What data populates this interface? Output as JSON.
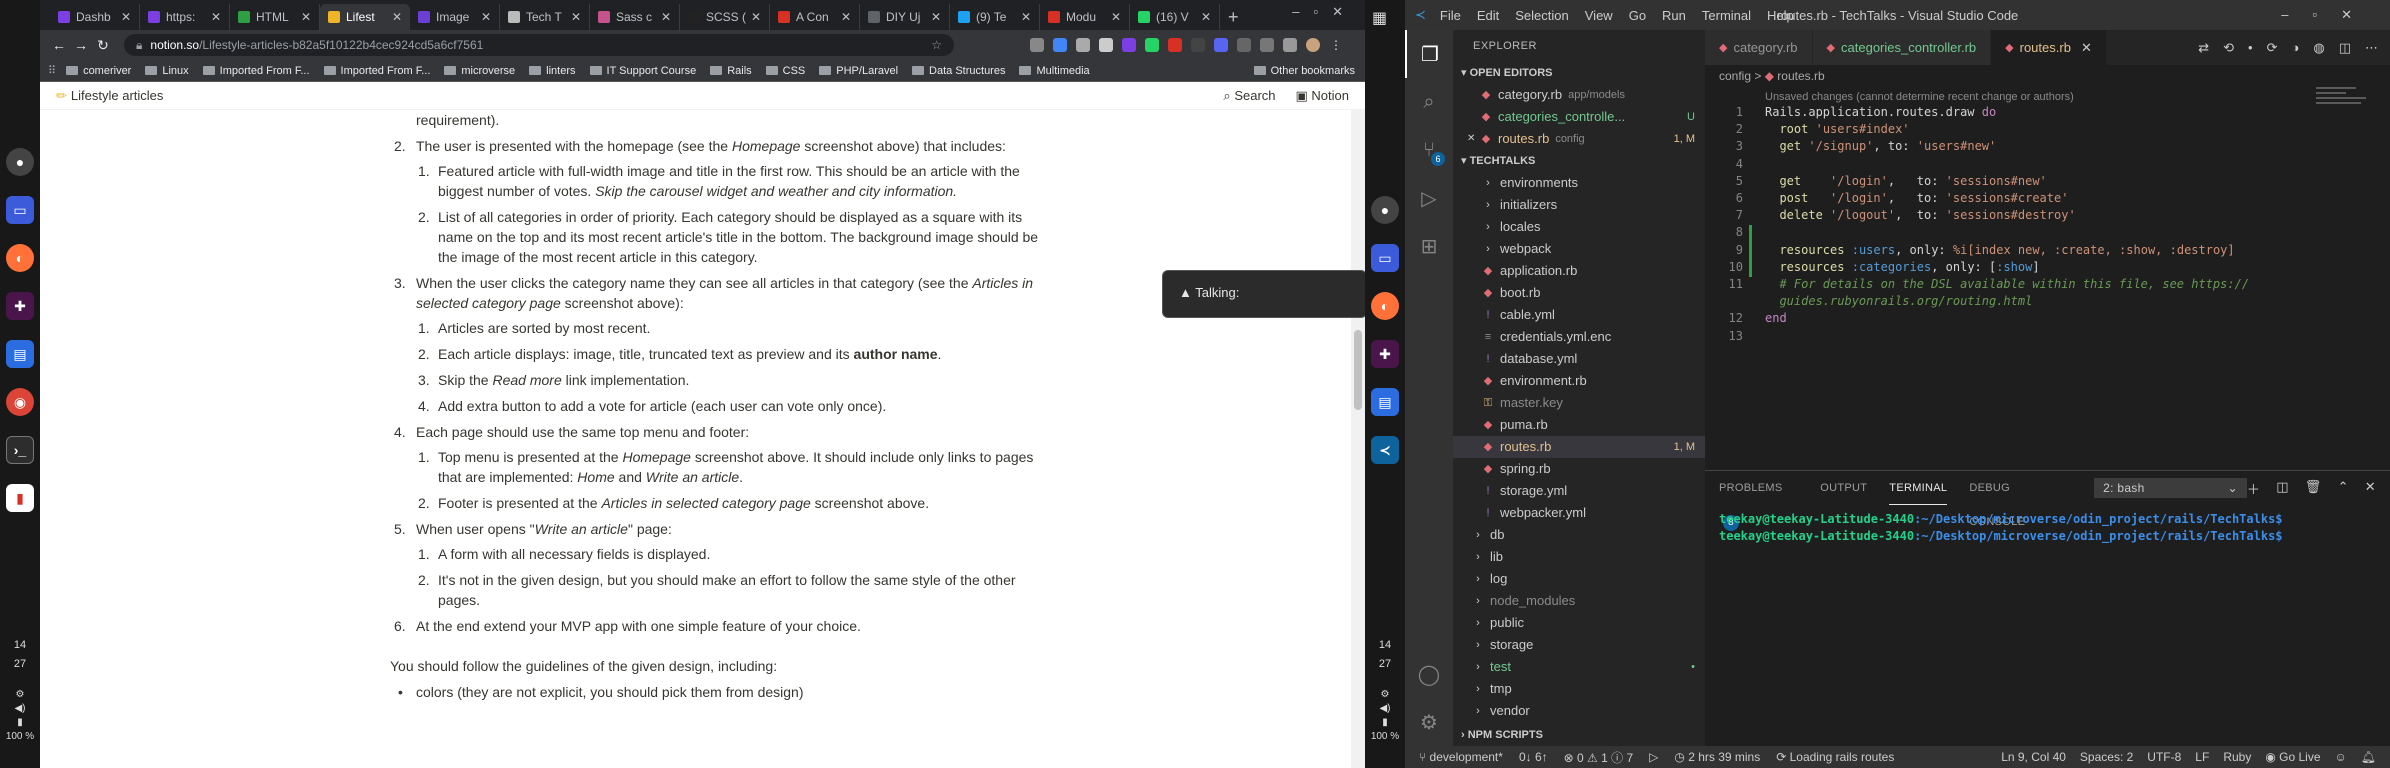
{
  "dock_left": {
    "clock_hour": "14",
    "clock_min": "27",
    "battery": "100 %"
  },
  "dock_mid": {
    "clock_hour": "14",
    "clock_min": "27",
    "battery": "100 %"
  },
  "browser": {
    "tabs": [
      {
        "label": "Dashb",
        "color": "#7b3fe4"
      },
      {
        "label": "https:",
        "color": "#7b3fe4"
      },
      {
        "label": "HTML",
        "color": "#2ea043"
      },
      {
        "label": "Lifest",
        "color": "#f0b429",
        "active": true
      },
      {
        "label": "Image",
        "color": "#6b3fd6"
      },
      {
        "label": "Tech T",
        "color": "#bbbbbb"
      },
      {
        "label": "Sass c",
        "color": "#c6538c"
      },
      {
        "label": "SCSS (",
        "color": "#222222"
      },
      {
        "label": "A Con",
        "color": "#d93025"
      },
      {
        "label": "DIY Uj",
        "color": "#5f6368"
      },
      {
        "label": "(9) Te",
        "color": "#1da1f2"
      },
      {
        "label": "Modu",
        "color": "#d93025"
      },
      {
        "label": "(16) V",
        "color": "#25d366"
      }
    ],
    "url_domain": "notion.so",
    "url_path": "/Lifestyle-articles-b82a5f10122b4cec924cd5a6cf7561",
    "bookmarks": [
      "comeriver",
      "Linux",
      "Imported From F...",
      "Imported From F...",
      "microverse",
      "linters",
      "IT Support Course",
      "Rails",
      "CSS",
      "PHP/Laravel",
      "Data Structures",
      "Multimedia"
    ],
    "other_bookmarks": "Other bookmarks"
  },
  "notion": {
    "page_title": "Lifestyle articles",
    "search": "Search",
    "notion": "Notion",
    "talking": "▲ Talking:"
  },
  "doc": {
    "l0": "requirement).",
    "l1_2": "The user is presented with the homepage (see the ",
    "l1_2_em": "Homepage",
    "l1_2_tail": " screenshot above) that includes:",
    "s2_1a": "Featured article with full-width image and title in the first row. This should be an article with the biggest number of votes. ",
    "s2_1em": "Skip the carousel widget and weather and city information.",
    "s2_2": "List of all categories in order of priority. Each category should be displayed as a square with its name on the top and its most recent article's title in the bottom. The background image should be the image of the most recent article in this category.",
    "l1_3": "When the user clicks the category name they can see all articles in that category (see the ",
    "l1_3_em": "Articles in selected category page",
    "l1_3_tail": " screenshot above):",
    "s3_1": "Articles are sorted by most recent.",
    "s3_2a": "Each article displays: image, title, truncated text as preview and its ",
    "s3_2b": "author name",
    "s3_2c": ".",
    "s3_3a": "Skip the ",
    "s3_3em": "Read more",
    "s3_3b": " link implementation.",
    "s3_4": "Add extra button to add a vote for article (each user can vote only once).",
    "l1_4": "Each page should use the same top menu and footer:",
    "s4_1a": "Top menu is presented at the ",
    "s4_1em1": "Homepage",
    "s4_1b": " screenshot above. It should include only links to pages that are implemented: ",
    "s4_1em2": "Home",
    "s4_1c": " and ",
    "s4_1em3": "Write an article",
    "s4_1d": ".",
    "s4_2a": "Footer is presented at the ",
    "s4_2em": "Articles in selected category page",
    "s4_2b": " screenshot above.",
    "l1_5a": "When user opens \"",
    "l1_5em": "Write an article",
    "l1_5b": "\" page:",
    "s5_1": "A form with all necessary fields is displayed.",
    "s5_2": "It's not in the given design, but you should make an effort to follow the same style of the other pages.",
    "l1_6": "At the end extend your MVP app with one simple feature of your choice.",
    "guidelines": "You should follow the guidelines of the given design, including:",
    "bullet1": "colors (they are not explicit, you should pick them from design)"
  },
  "vscode": {
    "menus": [
      "File",
      "Edit",
      "Selection",
      "View",
      "Go",
      "Run",
      "Terminal",
      "Help"
    ],
    "window_title": "routes.rb - TechTalks - Visual Studio Code",
    "explorer_title": "EXPLORER",
    "open_editors_title": "OPEN EDITORS",
    "open_editors": [
      {
        "name": "category.rb",
        "hint": "app/models",
        "flag": ""
      },
      {
        "name": "categories_controlle...",
        "hint": "",
        "flag": "U"
      },
      {
        "name": "routes.rb",
        "hint": "config",
        "flag": "1, M"
      }
    ],
    "project": "TECHTALKS",
    "tree": [
      {
        "name": "environments",
        "type": "folder",
        "flag": ""
      },
      {
        "name": "initializers",
        "type": "folder",
        "flag": ""
      },
      {
        "name": "locales",
        "type": "folder",
        "flag": ""
      },
      {
        "name": "webpack",
        "type": "folder",
        "flag": ""
      },
      {
        "name": "application.rb",
        "type": "ruby",
        "flag": ""
      },
      {
        "name": "boot.rb",
        "type": "ruby",
        "flag": ""
      },
      {
        "name": "cable.yml",
        "type": "yml",
        "flag": ""
      },
      {
        "name": "credentials.yml.enc",
        "type": "file",
        "flag": ""
      },
      {
        "name": "database.yml",
        "type": "yml",
        "flag": ""
      },
      {
        "name": "environment.rb",
        "type": "ruby",
        "flag": ""
      },
      {
        "name": "master.key",
        "type": "key",
        "flag": ""
      },
      {
        "name": "puma.rb",
        "type": "ruby",
        "flag": ""
      },
      {
        "name": "routes.rb",
        "type": "ruby",
        "flag": "1, M"
      },
      {
        "name": "spring.rb",
        "type": "ruby",
        "flag": ""
      },
      {
        "name": "storage.yml",
        "type": "yml",
        "flag": ""
      },
      {
        "name": "webpacker.yml",
        "type": "yml",
        "flag": ""
      }
    ],
    "tree2": [
      {
        "name": "db",
        "flag": ""
      },
      {
        "name": "lib",
        "flag": ""
      },
      {
        "name": "log",
        "flag": ""
      },
      {
        "name": "node_modules",
        "flag": ""
      },
      {
        "name": "public",
        "flag": ""
      },
      {
        "name": "storage",
        "flag": ""
      },
      {
        "name": "test",
        "flag": "•"
      },
      {
        "name": "tmp",
        "flag": ""
      },
      {
        "name": "vendor",
        "flag": ""
      }
    ],
    "npm_scripts": "NPM SCRIPTS",
    "editor_tabs": [
      {
        "name": "category.rb"
      },
      {
        "name": "categories_controller.rb"
      },
      {
        "name": "routes.rb",
        "active": true
      }
    ],
    "breadcrumb": [
      "config",
      "routes.rb"
    ],
    "hint": "Unsaved changes (cannot determine recent change or authors)",
    "code": [
      "Rails.application.routes.draw do",
      "  root 'users#index'",
      "  get '/signup', to: 'users#new'",
      "",
      "  get    '/login',   to: 'sessions#new'",
      "  post   '/login',   to: 'sessions#create'",
      "  delete '/logout',  to: 'sessions#destroy'",
      "",
      "  resources :users, only: %i[index new, :create, :show, :destroy]",
      "  resources :categories, only: [:show]",
      "  # For details on the DSL available within this file, see https://",
      "  guides.rubyonrails.org/routing.html",
      "end",
      ""
    ],
    "line_numbers": [
      "1",
      "2",
      "3",
      "4",
      "5",
      "6",
      "7",
      "8",
      "9",
      "10",
      "11",
      "",
      "12",
      "13"
    ],
    "panel_tabs": [
      "PROBLEMS",
      "OUTPUT",
      "TERMINAL",
      "DEBUG CONSOLE"
    ],
    "problems_count": "8",
    "terminal_select": "2: bash",
    "terminal_lines": [
      {
        "user": "teekay@teekay-Latitude-3440",
        "path": ":~/Desktop/microverse/odin_project/rails/TechTalks$"
      },
      {
        "user": "teekay@teekay-Latitude-3440",
        "path": ":~/Desktop/microverse/odin_project/rails/TechTalks$"
      }
    ],
    "status": {
      "branch": "development*",
      "sync": "0↓ 6↑",
      "errors": "⊗ 0 ⚠ 1 ⓘ 7",
      "time": "2 hrs 39 mins",
      "loading": "Loading rails routes",
      "position": "Ln 9, Col 40",
      "spaces": "Spaces: 2",
      "encoding": "UTF-8",
      "eol": "LF",
      "lang": "Ruby",
      "golive": "Go Live"
    }
  }
}
